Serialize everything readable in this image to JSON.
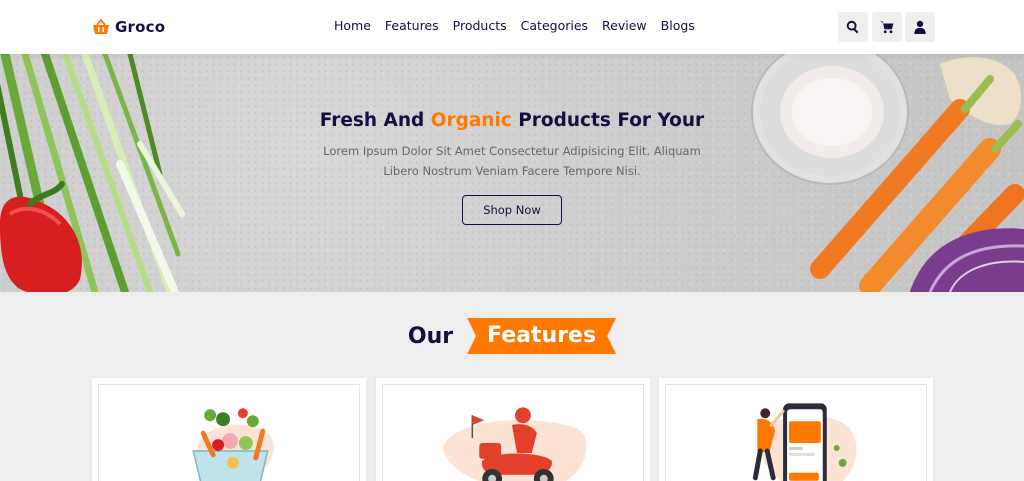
{
  "header": {
    "logo_text": "Groco",
    "logo_icon": "shopping-basket-icon",
    "nav": [
      "Home",
      "Features",
      "Products",
      "Categories",
      "Review",
      "Blogs"
    ],
    "icons": [
      "search-icon",
      "cart-icon",
      "user-icon"
    ]
  },
  "hero": {
    "title_pre": "Fresh And",
    "title_accent": "Organic",
    "title_post": "Products For Your",
    "subtitle": "Lorem Ipsum Dolor Sit Amet Consectetur Adipisicing Elit. Aliquam Libero Nostrum Veniam Facere Tempore Nisi.",
    "button": "Shop Now"
  },
  "features": {
    "heading_plain": "Our",
    "heading_accent": "Features",
    "cards": [
      "fresh-vegetables-illustration",
      "delivery-scooter-illustration",
      "mobile-shopping-illustration"
    ]
  },
  "colors": {
    "accent": "#ff7800",
    "dark": "#130f40",
    "background": "#eeeeee"
  }
}
